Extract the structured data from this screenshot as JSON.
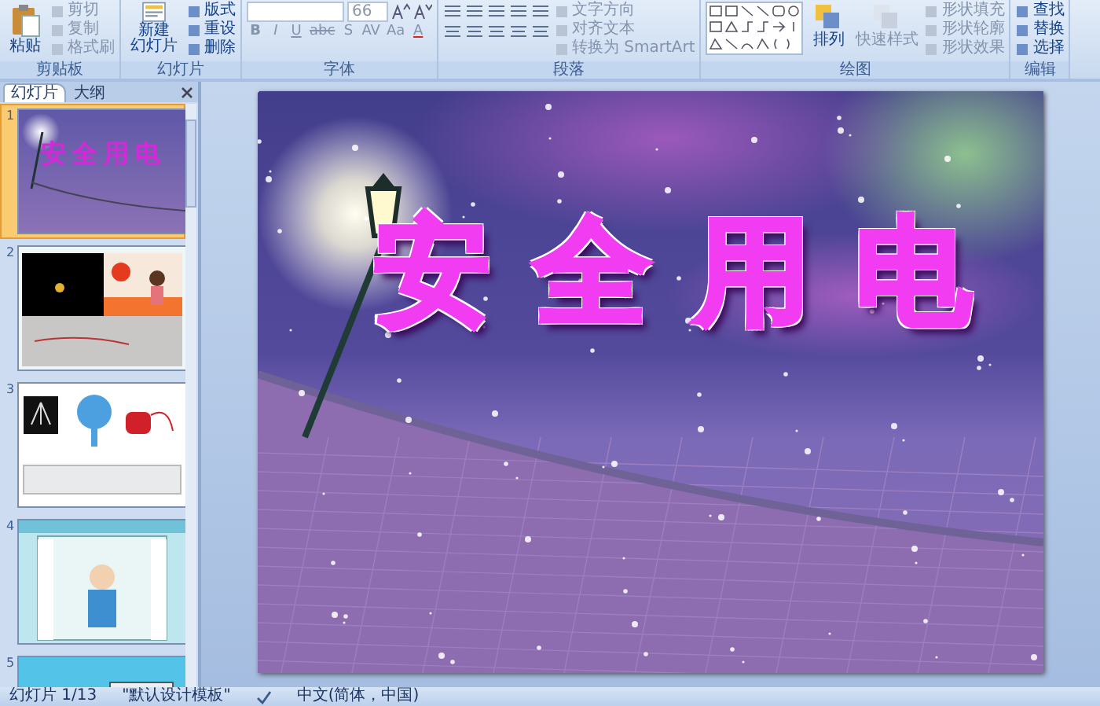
{
  "ribbon": {
    "groups": [
      {
        "label": "剪贴板",
        "large": [
          "粘贴"
        ],
        "small": [
          "剪切",
          "复制",
          "格式刷"
        ]
      },
      {
        "label": "幻灯片",
        "large": [
          "新建",
          "幻灯片"
        ],
        "small": [
          "版式",
          "重设",
          "删除"
        ]
      },
      {
        "label": "字体",
        "font_size": "66",
        "format_buttons": [
          "B",
          "I",
          "U",
          "abc",
          "S",
          "AV",
          "Aa",
          "A"
        ]
      },
      {
        "label": "段落",
        "small": [
          "文字方向",
          "对齐文本",
          "转换为 SmartArt"
        ]
      },
      {
        "label": "绘图",
        "large": [
          "排列",
          "快速样式"
        ],
        "small": [
          "形状填充",
          "形状轮廓",
          "形状效果"
        ]
      },
      {
        "label": "编辑",
        "small": [
          "查找",
          "替换",
          "选择"
        ]
      }
    ]
  },
  "slide_pane": {
    "tabs": [
      {
        "label": "幻灯片",
        "selected": true
      },
      {
        "label": "大纲",
        "selected": false
      }
    ],
    "slides": [
      {
        "number": "1",
        "kind": "title",
        "title": "安全用电",
        "selected": true
      },
      {
        "number": "2",
        "kind": "scene",
        "selected": false
      },
      {
        "number": "3",
        "kind": "appliances",
        "selected": false
      },
      {
        "number": "4",
        "kind": "window",
        "selected": false
      },
      {
        "number": "5",
        "kind": "cartoon",
        "selected": false
      }
    ]
  },
  "slide": {
    "title": "安全用电"
  },
  "status_bar": {
    "slide_count": "幻灯片 1/13",
    "theme": "\"默认设计模板\"",
    "language": "中文(简体，中国)"
  }
}
